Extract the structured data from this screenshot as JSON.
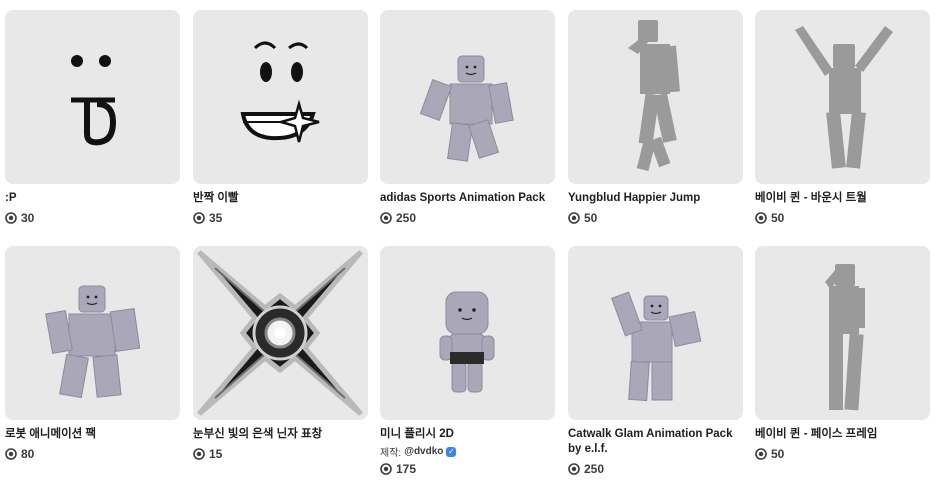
{
  "items": [
    {
      "name": ":P",
      "price": "30"
    },
    {
      "name": "반짝 이빨",
      "price": "35"
    },
    {
      "name": "adidas Sports Animation Pack",
      "price": "250"
    },
    {
      "name": "Yungblud Happier Jump",
      "price": "50"
    },
    {
      "name": "베이비 퀸 - 바운시 트월",
      "price": "50"
    },
    {
      "name": "로봇 애니메이션 팩",
      "price": "80"
    },
    {
      "name": "눈부신 빛의 은색 닌자 표창",
      "price": "15"
    },
    {
      "name": "미니 플리시 2D",
      "creator_prefix": "제작:",
      "creator": "@dvdko",
      "price": "175"
    },
    {
      "name": "Catwalk Glam Animation Pack by e.l.f.",
      "price": "250"
    },
    {
      "name": "베이비 퀸 - 페이스 프레임",
      "price": "50"
    }
  ],
  "icons": {
    "currency": "robux-icon",
    "verified": "verified-badge-icon"
  },
  "colors": {
    "thumb_bg": "#e8e8e8",
    "avatar": "#a9a7b8",
    "silhouette": "#9a9a9a",
    "text": "#1f1f1f"
  }
}
